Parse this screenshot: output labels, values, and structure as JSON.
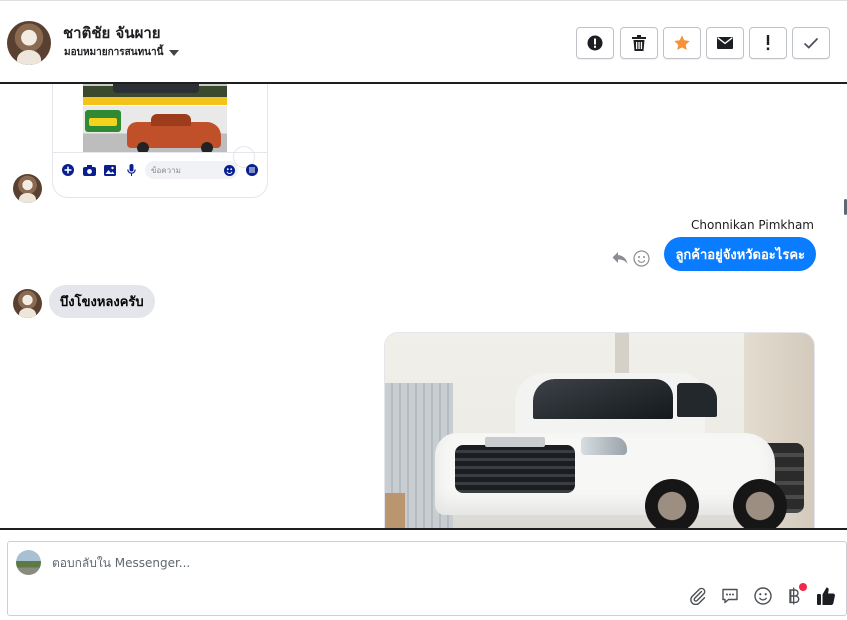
{
  "header": {
    "contact_name": "ชาติชัย จันผาย",
    "assign_label": "มอบหมายการสนทนานี้",
    "buttons": [
      {
        "name": "spam-button",
        "icon": "alert-circle-icon"
      },
      {
        "name": "delete-button",
        "icon": "trash-icon"
      },
      {
        "name": "star-button",
        "icon": "star-icon",
        "color": "#f7923a"
      },
      {
        "name": "mark-unread-button",
        "icon": "envelope-icon"
      },
      {
        "name": "important-button",
        "icon": "exclamation-icon"
      },
      {
        "name": "done-button",
        "icon": "check-icon"
      }
    ]
  },
  "phone_card": {
    "input_placeholder": "ข้อความ",
    "accent_color": "#0a1f8f"
  },
  "conversation": {
    "outgoing": {
      "sender": "Chonnikan Pimkham",
      "text": "ลูกค้าอยู่จังหวัดอะไรคะ",
      "bubble_color": "#0a7cff"
    },
    "incoming": {
      "text": "บึงโขงหลงครับ"
    }
  },
  "composer": {
    "placeholder": "ตอบกลับใน Messenger...",
    "icons": [
      "paperclip-icon",
      "saved-reply-icon",
      "emoji-icon",
      "baht-payment-icon",
      "thumbs-up-icon"
    ]
  }
}
